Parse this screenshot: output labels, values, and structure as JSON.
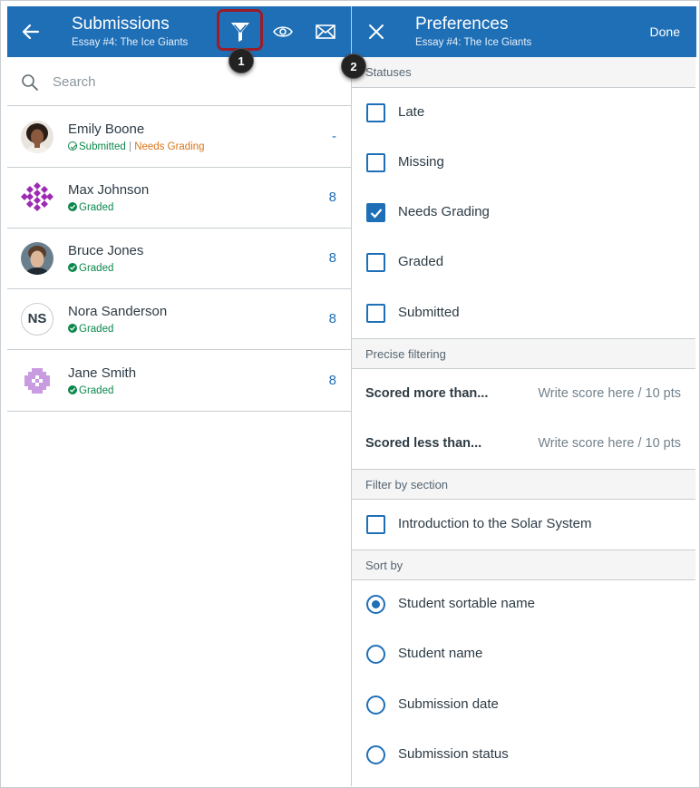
{
  "colors": {
    "header_bg": "#1f6fb7",
    "accent": "#1f6fb7",
    "graded_green": "#0b874b",
    "needs_grading_orange": "#d9751c",
    "highlight_border": "#9b1c2a"
  },
  "left_header": {
    "title": "Submissions",
    "subtitle": "Essay #4: The Ice Giants",
    "icons": [
      "back-arrow-icon",
      "filter-icon",
      "eye-icon",
      "mail-icon"
    ]
  },
  "callouts": [
    "1",
    "2"
  ],
  "search": {
    "placeholder": "Search",
    "value": ""
  },
  "students": [
    {
      "name": "Emily Boone",
      "status": "Submitted",
      "status_extra": "Needs Grading",
      "score": "-",
      "avatar": "photo"
    },
    {
      "name": "Max Johnson",
      "status": "Graded",
      "score": "8",
      "avatar": "pattern-purple"
    },
    {
      "name": "Bruce Jones",
      "status": "Graded",
      "score": "8",
      "avatar": "photo"
    },
    {
      "name": "Nora Sanderson",
      "status": "Graded",
      "score": "8",
      "avatar": "initials",
      "initials": "NS"
    },
    {
      "name": "Jane Smith",
      "status": "Graded",
      "score": "8",
      "avatar": "pattern-lavender"
    }
  ],
  "status_separator": "|",
  "right_header": {
    "title": "Preferences",
    "subtitle": "Essay #4: The Ice Giants",
    "done_label": "Done",
    "icons": [
      "close-icon"
    ]
  },
  "statuses_section": {
    "header": "Statuses",
    "options": [
      {
        "label": "Late",
        "checked": false
      },
      {
        "label": "Missing",
        "checked": false
      },
      {
        "label": "Needs Grading",
        "checked": true
      },
      {
        "label": "Graded",
        "checked": false
      },
      {
        "label": "Submitted",
        "checked": false
      }
    ]
  },
  "precise_filtering": {
    "header": "Precise filtering",
    "rows": [
      {
        "label": "Scored more than...",
        "placeholder": "Write score here / 10 pts",
        "value": ""
      },
      {
        "label": "Scored less than...",
        "placeholder": "Write score here / 10 pts",
        "value": ""
      }
    ]
  },
  "filter_by_section": {
    "header": "Filter by section",
    "options": [
      {
        "label": "Introduction to the Solar System",
        "checked": false
      }
    ]
  },
  "sort_by": {
    "header": "Sort by",
    "options": [
      {
        "label": "Student sortable name",
        "selected": true
      },
      {
        "label": "Student name",
        "selected": false
      },
      {
        "label": "Submission date",
        "selected": false
      },
      {
        "label": "Submission status",
        "selected": false
      }
    ]
  }
}
